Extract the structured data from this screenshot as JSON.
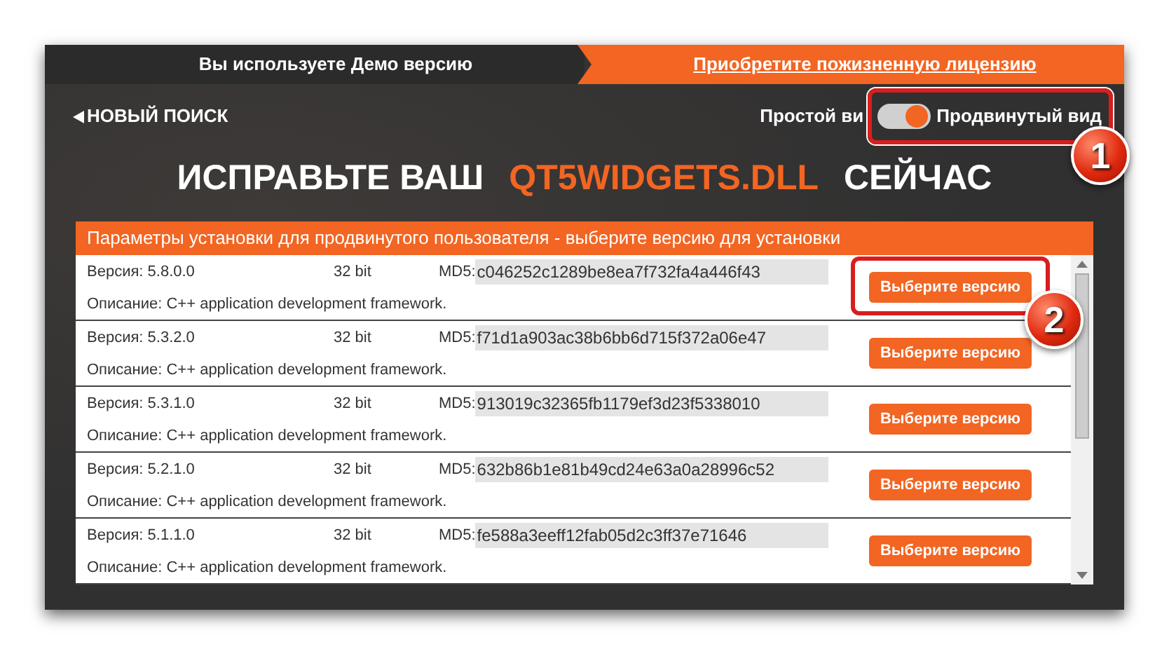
{
  "banner": {
    "status": "Вы используете Демо версию",
    "link": "Приобретите пожизненную лицензию"
  },
  "back_link": "НОВЫЙ ПОИСК",
  "view_toggle": {
    "left_label": "Простой ви",
    "right_label": "Продвинутый вид",
    "on": true
  },
  "heading": {
    "prefix": "ИСПРАВЬТЕ ВАШ",
    "file": "QT5WIDGETS.DLL",
    "suffix": "СЕЙЧАС"
  },
  "panel": {
    "title": "Параметры установки для продвинутого пользователя - выберите версию для установки",
    "versions": [
      {
        "version": "Версия: 5.8.0.0",
        "bits": "32 bit",
        "md5_label": "MD5:",
        "md5": "c046252c1289be8ea7f732fa4a446f43",
        "description": "Описание: C++ application development framework.",
        "button": "Выберите версию"
      },
      {
        "version": "Версия: 5.3.2.0",
        "bits": "32 bit",
        "md5_label": "MD5:",
        "md5": "f71d1a903ac38b6bb6d715f372a06e47",
        "description": "Описание: C++ application development framework.",
        "button": "Выберите версию"
      },
      {
        "version": "Версия: 5.3.1.0",
        "bits": "32 bit",
        "md5_label": "MD5:",
        "md5": "913019c32365fb1179ef3d23f5338010",
        "description": "Описание: C++ application development framework.",
        "button": "Выберите версию"
      },
      {
        "version": "Версия: 5.2.1.0",
        "bits": "32 bit",
        "md5_label": "MD5:",
        "md5": "632b86b1e81b49cd24e63a0a28996c52",
        "description": "Описание: C++ application development framework.",
        "button": "Выберите версию"
      },
      {
        "version": "Версия: 5.1.1.0",
        "bits": "32 bit",
        "md5_label": "MD5:",
        "md5": "fe588a3eeff12fab05d2c3ff37e71646",
        "description": "Описание: C++ application development framework.",
        "button": "Выберите версию"
      }
    ]
  },
  "callouts": [
    {
      "number": "1"
    },
    {
      "number": "2"
    }
  ]
}
